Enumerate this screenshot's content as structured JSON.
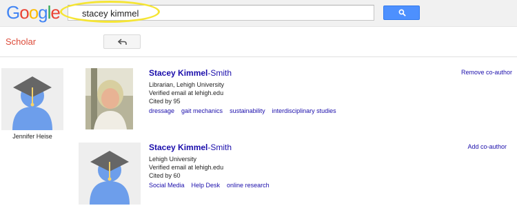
{
  "logo": {
    "letters": [
      "G",
      "o",
      "o",
      "g",
      "l",
      "e"
    ],
    "colors": [
      "#4285f4",
      "#ea4335",
      "#fbbc05",
      "#4285f4",
      "#34a853",
      "#ea4335"
    ]
  },
  "search": {
    "value": "stacey kimmel"
  },
  "subbar": {
    "scholar_label": "Scholar"
  },
  "left_profile": {
    "name": "Jennifer Heise"
  },
  "results": [
    {
      "name_bold": "Stacey Kimmel",
      "name_rest": "-Smith",
      "affiliation": "Librarian, Lehigh University",
      "email": "Verified email at lehigh.edu",
      "cited": "Cited by 95",
      "tags": [
        "dressage",
        "gait mechanics",
        "sustainability",
        "interdisciplinary studies"
      ],
      "action": "Remove co-author"
    },
    {
      "name_bold": "Stacey Kimmel",
      "name_rest": "-Smith",
      "affiliation": "Lehigh University",
      "email": "Verified email at lehigh.edu",
      "cited": "Cited by 60",
      "tags": [
        "Social Media",
        "Help Desk",
        "online research"
      ],
      "action": "Add co-author"
    }
  ],
  "colors": {
    "accent": "#4d90fe",
    "link": "#1a0dab",
    "scholar": "#dd4b39",
    "highlight": "#f5e534"
  }
}
